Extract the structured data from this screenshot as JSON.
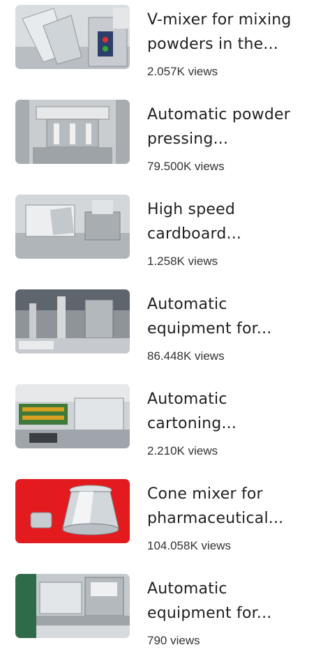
{
  "videos": [
    {
      "title_line1": "V-mixer for mixing",
      "title_line2": "powders in the...",
      "views": "2.057K views",
      "thumb_icon": "v-mixer-machine-thumbnail"
    },
    {
      "title_line1": "Automatic powder",
      "title_line2": "pressing...",
      "views": "79.500K views",
      "thumb_icon": "powder-press-thumbnail"
    },
    {
      "title_line1": "High speed",
      "title_line2": "cardboard...",
      "views": "1.258K views",
      "thumb_icon": "cardboard-machine-thumbnail"
    },
    {
      "title_line1": "Automatic",
      "title_line2": "equipment for...",
      "views": "86.448K views",
      "thumb_icon": "automatic-equipment-thumbnail"
    },
    {
      "title_line1": "Automatic",
      "title_line2": "cartoning...",
      "views": "2.210K views",
      "thumb_icon": "cartoning-machine-thumbnail"
    },
    {
      "title_line1": "Cone mixer for",
      "title_line2": "pharmaceutical...",
      "views": "104.058K views",
      "thumb_icon": "cone-mixer-thumbnail"
    },
    {
      "title_line1": "Automatic",
      "title_line2": "equipment for...",
      "views": "790 views",
      "thumb_icon": "equipment-line-thumbnail"
    }
  ]
}
